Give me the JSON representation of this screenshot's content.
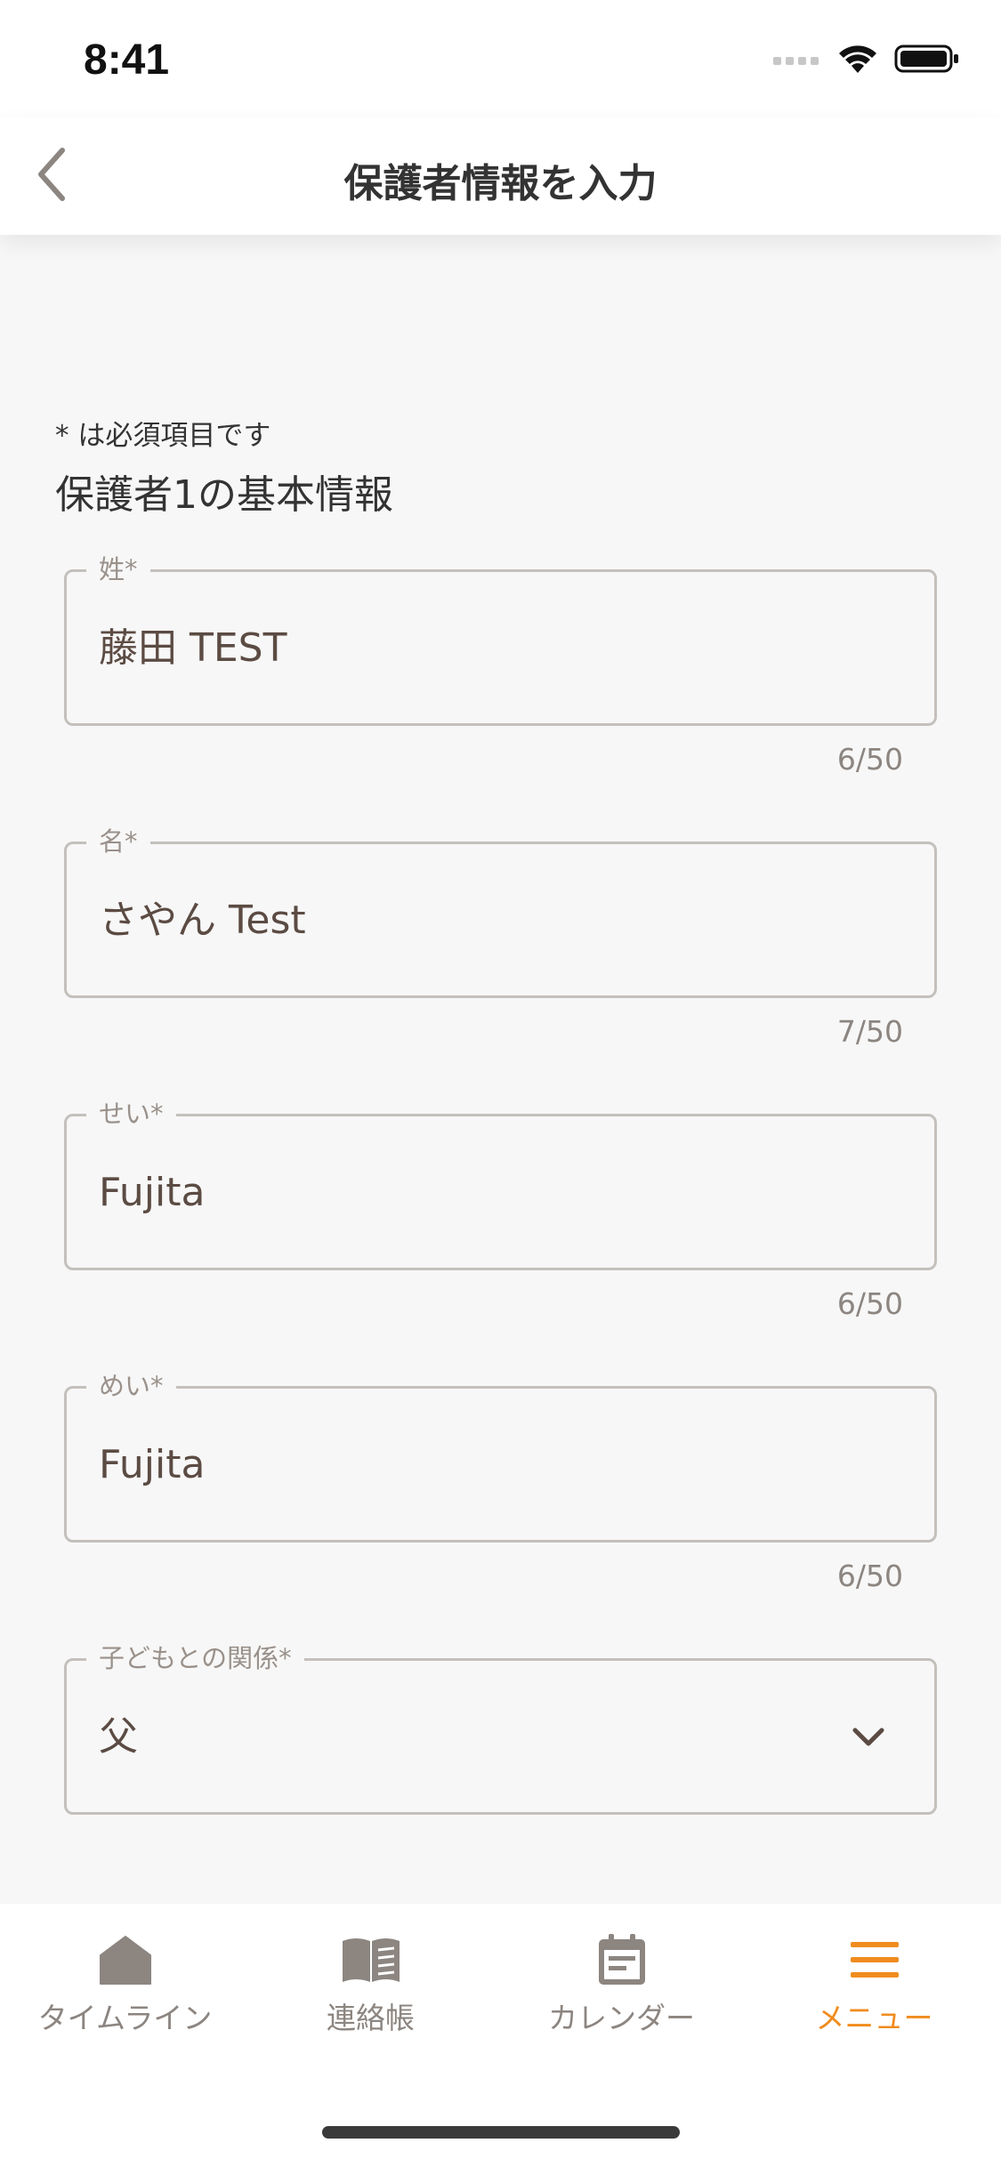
{
  "status_bar": {
    "time": "8:41"
  },
  "nav": {
    "title": "保護者情報を入力",
    "back_icon": "chevron-left-icon"
  },
  "form": {
    "required_note": "* は必須項目です",
    "section_title": "保護者1の基本情報",
    "fields": [
      {
        "label": "姓*",
        "value": "藤田 TEST",
        "count": "6/50"
      },
      {
        "label": "名*",
        "value": "さやん Test",
        "count": "7/50"
      },
      {
        "label": "せい*",
        "value": "Fujita",
        "count": "6/50"
      },
      {
        "label": "めい*",
        "value": "Fujita",
        "count": "6/50"
      },
      {
        "label": "子どもとの関係*",
        "value": "父",
        "type": "select"
      }
    ]
  },
  "tabs": [
    {
      "label": "タイムライン",
      "icon": "home-icon",
      "active": false
    },
    {
      "label": "連絡帳",
      "icon": "book-icon",
      "active": false
    },
    {
      "label": "カレンダー",
      "icon": "calendar-icon",
      "active": false
    },
    {
      "label": "メニュー",
      "icon": "menu-icon",
      "active": true
    }
  ],
  "colors": {
    "accent": "#f08c1e",
    "inactive": "#8c8580",
    "text": "#5b4b43",
    "border": "#c4c0bc"
  }
}
